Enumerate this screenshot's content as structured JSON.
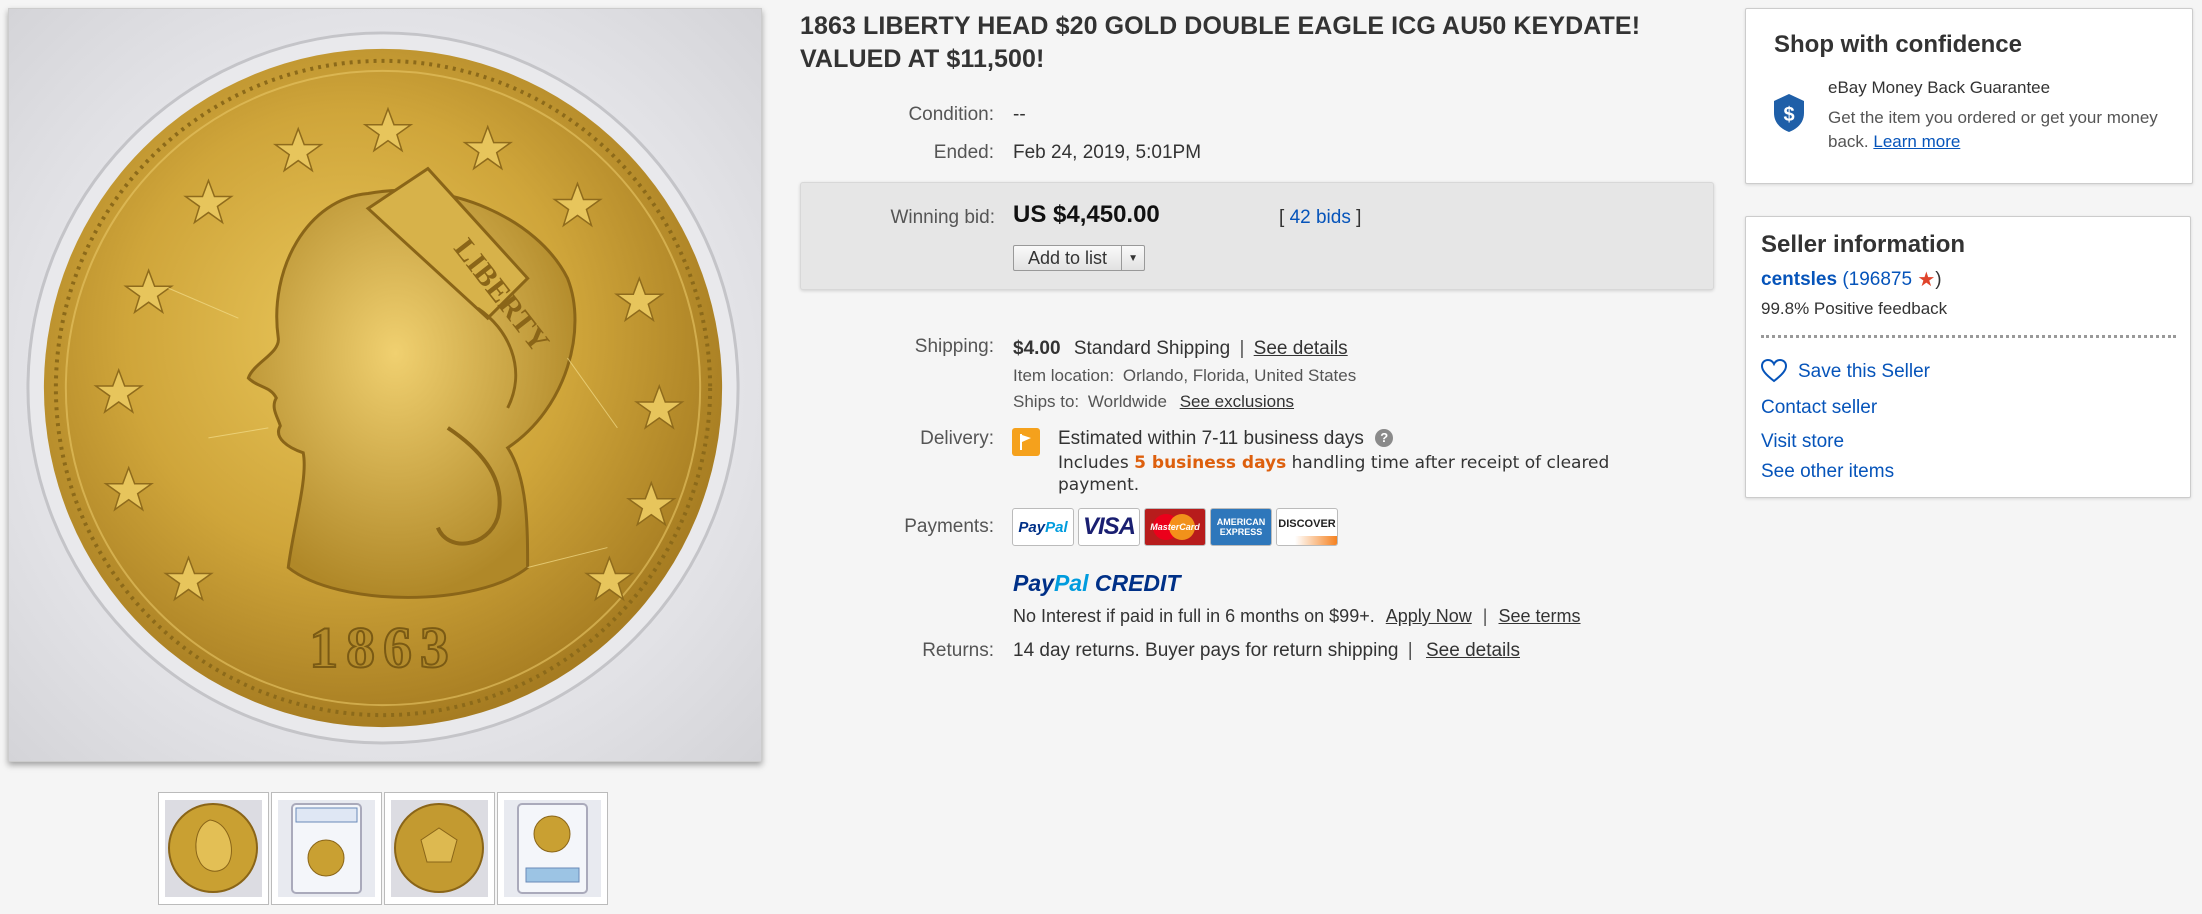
{
  "listing": {
    "title": "1863 LIBERTY HEAD $20 GOLD DOUBLE EAGLE ICG AU50 KEYDATE! VALUED AT $11,500!",
    "coin_year": "1863",
    "coin_crown_text": "LIBERTY",
    "condition_label": "Condition:",
    "condition_value": "--",
    "ended_label": "Ended:",
    "ended_value": "Feb 24, 2019, 5:01PM"
  },
  "bid": {
    "label": "Winning bid:",
    "price": "US $4,450.00",
    "bids_open": "[",
    "bids_link": "42 bids",
    "bids_close": "]",
    "add_to_list": "Add to list"
  },
  "shipping": {
    "label": "Shipping:",
    "price": "$4.00",
    "method": "Standard Shipping",
    "details_link": "See details",
    "location_label": "Item location:",
    "location_value": "Orlando, Florida, United States",
    "ships_label": "Ships to:",
    "ships_value": "Worldwide",
    "exclusions_link": "See exclusions"
  },
  "delivery": {
    "label": "Delivery:",
    "estimate": "Estimated within 7-11 business days",
    "includes_prefix": "Includes",
    "handling_days": "5 business days",
    "includes_suffix": "handling time after receipt of cleared",
    "line3": "payment."
  },
  "payments": {
    "label": "Payments:",
    "methods": [
      "PayPal",
      "VISA",
      "MasterCard",
      "AMERICAN EXPRESS",
      "DISCOVER"
    ],
    "paypal_credit": "PayPal CREDIT",
    "credit_text": "No Interest if paid in full in 6 months on $99+.",
    "apply_link": "Apply Now",
    "terms_link": "See terms"
  },
  "returns": {
    "label": "Returns:",
    "text": "14 day returns. Buyer pays for return shipping",
    "details_link": "See details"
  },
  "confidence": {
    "title": "Shop with confidence",
    "guarantee_title": "eBay Money Back Guarantee",
    "guarantee_text": "Get the item you ordered or get your money back.",
    "learn_more": "Learn more"
  },
  "seller": {
    "title": "Seller information",
    "name": "centsles",
    "score": "196875",
    "positive_feedback": "99.8% Positive feedback",
    "save_seller": "Save this Seller",
    "contact": "Contact seller",
    "visit_store": "Visit store",
    "other_items": "See other items"
  },
  "colors": {
    "link": "#0654ba",
    "accent_orange": "#dd5f0d",
    "gold": "#c9a032"
  }
}
